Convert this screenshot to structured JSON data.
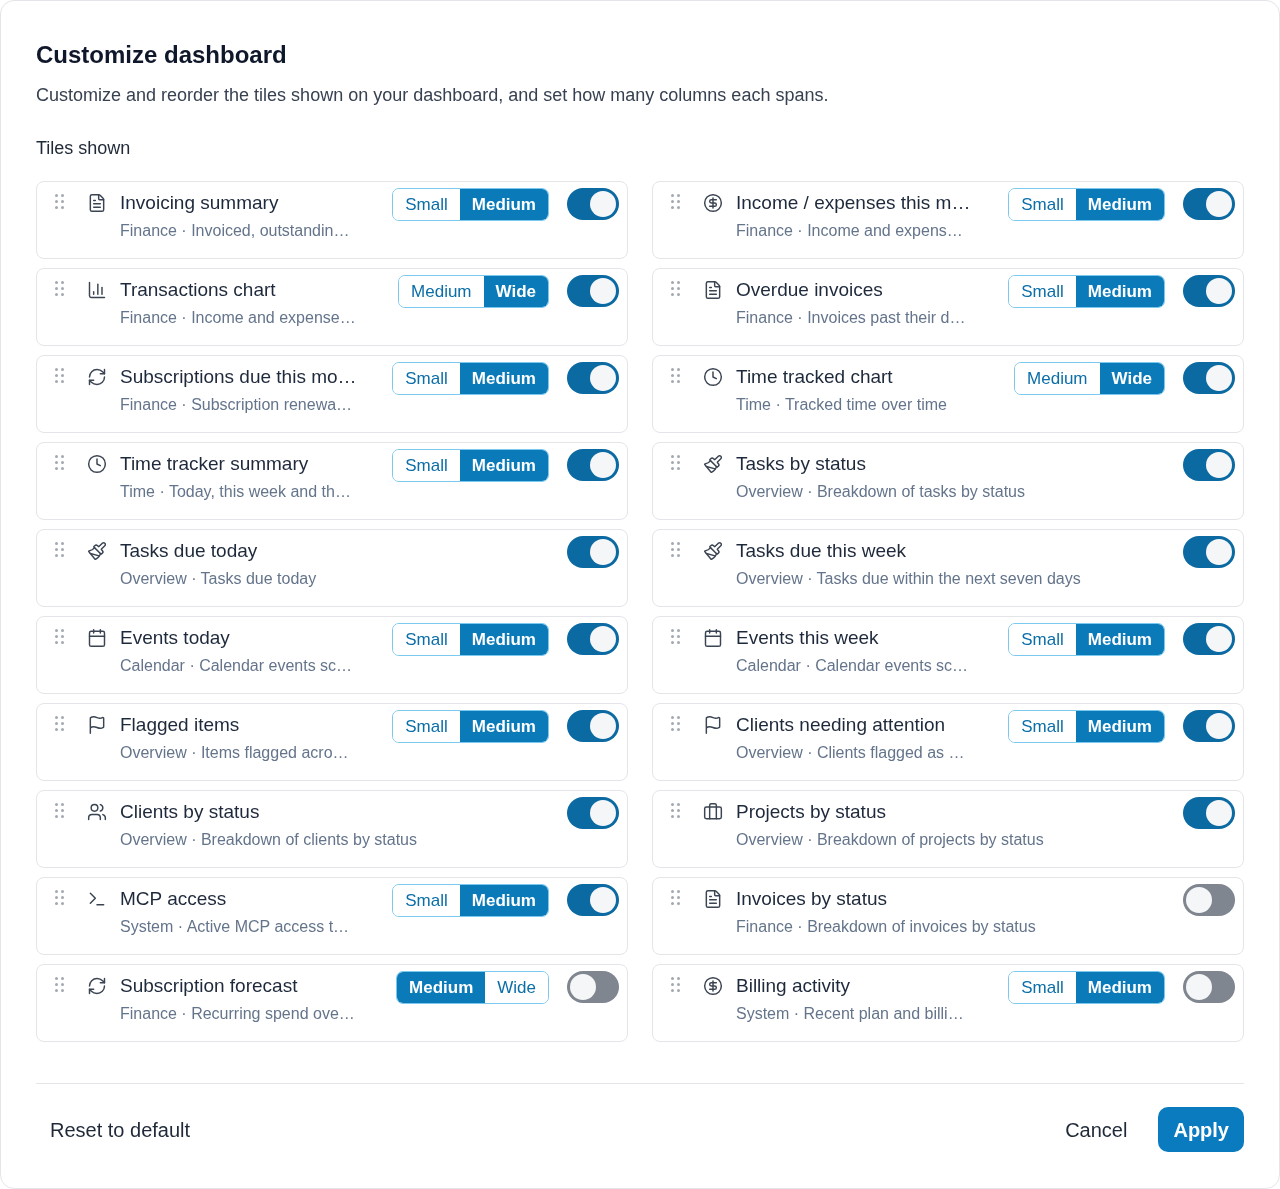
{
  "dialog": {
    "title": "Customize dashboard",
    "description": "Customize and reorder the tiles shown on your dashboard, and set how many columns each spans."
  },
  "section": {
    "title": "Tiles shown"
  },
  "tiles": [
    {
      "title": "Invoicing summary",
      "subtitle": "Finance · Invoiced, outstandin…",
      "sizes": [
        {
          "label": "Small",
          "selected": false
        },
        {
          "label": "Medium",
          "selected": true
        }
      ],
      "on": true
    },
    {
      "title": "Income / expenses this m…",
      "subtitle": "Finance · Income and expens…",
      "sizes": [
        {
          "label": "Small",
          "selected": false
        },
        {
          "label": "Medium",
          "selected": true
        }
      ],
      "on": true
    },
    {
      "title": "Transactions chart",
      "subtitle": "Finance · Income and expense…",
      "sizes": [
        {
          "label": "Medium",
          "selected": false
        },
        {
          "label": "Wide",
          "selected": true
        }
      ],
      "on": true
    },
    {
      "title": "Overdue invoices",
      "subtitle": "Finance · Invoices past their d…",
      "sizes": [
        {
          "label": "Small",
          "selected": false
        },
        {
          "label": "Medium",
          "selected": true
        }
      ],
      "on": true
    },
    {
      "title": "Subscriptions due this mo…",
      "subtitle": "Finance · Subscription renewa…",
      "sizes": [
        {
          "label": "Small",
          "selected": false
        },
        {
          "label": "Medium",
          "selected": true
        }
      ],
      "on": true
    },
    {
      "title": "Time tracked chart",
      "subtitle": "Time · Tracked time over time",
      "sizes": [
        {
          "label": "Medium",
          "selected": false
        },
        {
          "label": "Wide",
          "selected": true
        }
      ],
      "on": true
    },
    {
      "title": "Time tracker summary",
      "subtitle": "Time · Today, this week and th…",
      "sizes": [
        {
          "label": "Small",
          "selected": false
        },
        {
          "label": "Medium",
          "selected": true
        }
      ],
      "on": true
    },
    {
      "title": "Tasks by status",
      "subtitle": "Overview · Breakdown of tasks by status",
      "on": true
    },
    {
      "title": "Tasks due today",
      "subtitle": "Overview · Tasks due today",
      "on": true
    },
    {
      "title": "Tasks due this week",
      "subtitle": "Overview · Tasks due within the next seven days",
      "on": true
    },
    {
      "title": "Events today",
      "subtitle": "Calendar · Calendar events sc…",
      "sizes": [
        {
          "label": "Small",
          "selected": false
        },
        {
          "label": "Medium",
          "selected": true
        }
      ],
      "on": true
    },
    {
      "title": "Events this week",
      "subtitle": "Calendar · Calendar events sc…",
      "sizes": [
        {
          "label": "Small",
          "selected": false
        },
        {
          "label": "Medium",
          "selected": true
        }
      ],
      "on": true
    },
    {
      "title": "Flagged items",
      "subtitle": "Overview · Items flagged acro…",
      "sizes": [
        {
          "label": "Small",
          "selected": false
        },
        {
          "label": "Medium",
          "selected": true
        }
      ],
      "on": true
    },
    {
      "title": "Clients needing attention",
      "subtitle": "Overview · Clients flagged as …",
      "sizes": [
        {
          "label": "Small",
          "selected": false
        },
        {
          "label": "Medium",
          "selected": true
        }
      ],
      "on": true
    },
    {
      "title": "Clients by status",
      "subtitle": "Overview · Breakdown of clients by status",
      "on": true
    },
    {
      "title": "Projects by status",
      "subtitle": "Overview · Breakdown of projects by status",
      "on": true
    },
    {
      "title": "MCP access",
      "subtitle": "System · Active MCP access t…",
      "sizes": [
        {
          "label": "Small",
          "selected": false
        },
        {
          "label": "Medium",
          "selected": true
        }
      ],
      "on": true
    },
    {
      "title": "Invoices by status",
      "subtitle": "Finance · Breakdown of invoices by status",
      "on": false
    },
    {
      "title": "Subscription forecast",
      "subtitle": "Finance · Recurring spend ove…",
      "sizes": [
        {
          "label": "Medium",
          "selected": true
        },
        {
          "label": "Wide",
          "selected": false
        }
      ],
      "on": false
    },
    {
      "title": "Billing activity",
      "subtitle": "System · Recent plan and billi…",
      "sizes": [
        {
          "label": "Small",
          "selected": false
        },
        {
          "label": "Medium",
          "selected": true
        }
      ],
      "on": false
    }
  ],
  "footer": {
    "reset": "Reset to default",
    "cancel": "Cancel",
    "apply": "Apply"
  }
}
